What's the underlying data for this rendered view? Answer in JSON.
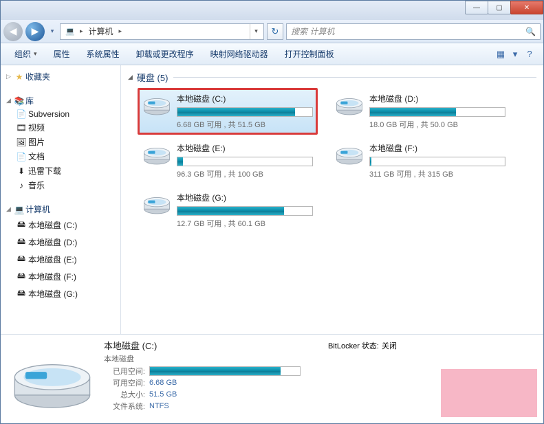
{
  "titlebar": {
    "min": "—",
    "max": "▢",
    "close": "✕"
  },
  "nav": {
    "back": "◀",
    "fwd": "▶",
    "dd": "▾"
  },
  "breadcrumb": {
    "root_icon": "💻",
    "root_label": "计算机",
    "arrow": "▸",
    "dd": "▾"
  },
  "refresh": "↻",
  "search": {
    "placeholder": "搜索 计算机",
    "icon": "🔍"
  },
  "toolbar": {
    "organize": "组织",
    "properties": "属性",
    "sys_properties": "系统属性",
    "uninstall": "卸载或更改程序",
    "map_drive": "映射网络驱动器",
    "control_panel": "打开控制面板",
    "view_icon": "▦",
    "view_dd": "▾",
    "help_icon": "?"
  },
  "sidebar": {
    "favorites": {
      "label": "收藏夹",
      "icon": "★"
    },
    "libraries": {
      "label": "库",
      "icon": "📚",
      "items": [
        {
          "icon": "📄",
          "label": "Subversion"
        },
        {
          "icon": "🎞",
          "label": "视频"
        },
        {
          "icon": "🖼",
          "label": "图片"
        },
        {
          "icon": "📄",
          "label": "文档"
        },
        {
          "icon": "⬇",
          "label": "迅雷下载"
        },
        {
          "icon": "♪",
          "label": "音乐"
        }
      ]
    },
    "computer": {
      "label": "计算机",
      "icon": "💻",
      "items": [
        {
          "icon": "🖴",
          "label": "本地磁盘 (C:)"
        },
        {
          "icon": "🖴",
          "label": "本地磁盘 (D:)"
        },
        {
          "icon": "🖴",
          "label": "本地磁盘 (E:)"
        },
        {
          "icon": "🖴",
          "label": "本地磁盘 (F:)"
        },
        {
          "icon": "🖴",
          "label": "本地磁盘 (G:)"
        }
      ]
    }
  },
  "group": {
    "label": "硬盘 (5)",
    "twisty": "◢"
  },
  "drives": [
    {
      "name": "本地磁盘 (C:)",
      "info": "6.68 GB 可用 , 共 51.5 GB",
      "fill_pct": 87,
      "selected": true
    },
    {
      "name": "本地磁盘 (D:)",
      "info": "18.0 GB 可用 , 共 50.0 GB",
      "fill_pct": 64,
      "selected": false
    },
    {
      "name": "本地磁盘 (E:)",
      "info": "96.3 GB 可用 , 共 100 GB",
      "fill_pct": 4,
      "selected": false
    },
    {
      "name": "本地磁盘 (F:)",
      "info": "311 GB 可用 , 共 315 GB",
      "fill_pct": 1,
      "selected": false
    },
    {
      "name": "本地磁盘 (G:)",
      "info": "12.7 GB 可用 , 共 60.1 GB",
      "fill_pct": 79,
      "selected": false
    }
  ],
  "details": {
    "title": "本地磁盘 (C:)",
    "subtitle": "本地磁盘",
    "used_label": "已用空间:",
    "used_fill_pct": 87,
    "free_label": "可用空间:",
    "free_val": "6.68 GB",
    "total_label": "总大小:",
    "total_val": "51.5 GB",
    "fs_label": "文件系统:",
    "fs_val": "NTFS",
    "bitlocker_label": "BitLocker 状态:",
    "bitlocker_val": "关闭"
  }
}
